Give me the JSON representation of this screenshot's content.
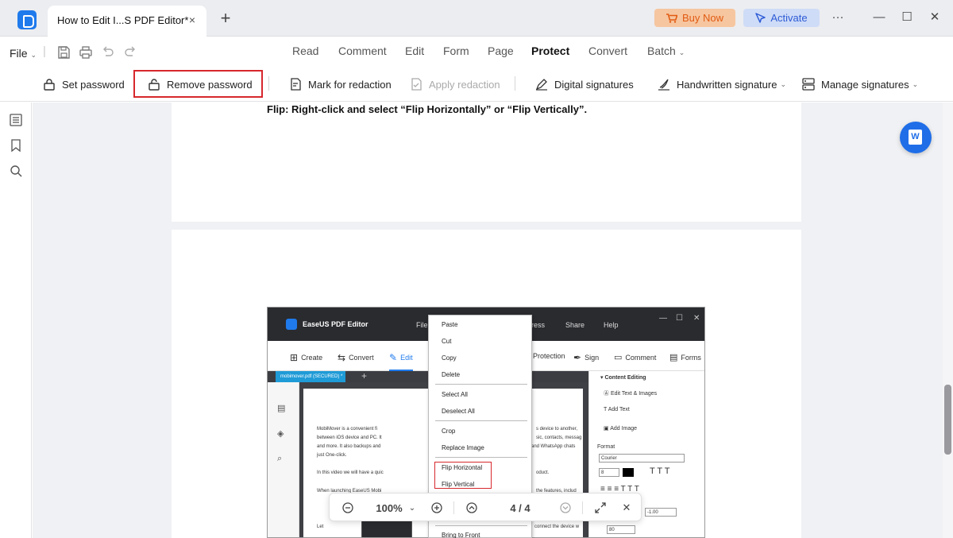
{
  "window": {
    "tab_title": "How to Edit I...S PDF Editor*",
    "tab_close": "×",
    "new_tab": "+",
    "buy_now": "Buy Now",
    "activate": "Activate",
    "more": "···",
    "minimize": "—",
    "maximize": "☐",
    "close": "✕"
  },
  "menu": {
    "file": "File",
    "tabs": [
      "Read",
      "Comment",
      "Edit",
      "Form",
      "Page",
      "Protect",
      "Convert",
      "Batch"
    ],
    "active_tab": "Protect"
  },
  "ribbon": {
    "set_password": "Set password",
    "remove_password": "Remove password",
    "mark_for_redaction": "Mark for redaction",
    "apply_redaction": "Apply redaction",
    "digital_signatures": "Digital signatures",
    "handwritten_signature": "Handwritten signature",
    "manage_signatures": "Manage signatures"
  },
  "document": {
    "flip_instruction": "Flip: Right-click and select “Flip Horizontally” or “Flip Vertically”."
  },
  "embedded": {
    "app_name": "EaseUS PDF Editor",
    "menus": [
      "File",
      "ress",
      "Share",
      "Help"
    ],
    "toolbar": [
      "Create",
      "Convert",
      "Edit",
      "Protection",
      "Sign",
      "Comment",
      "Forms"
    ],
    "file_tab": "mobimover.pdf (SECURED) *",
    "page_lines_left": [
      "MobiMover is a convenient fi",
      "between iOS device and PC. It",
      "and more. It also backups and",
      "just One-click.",
      "In this video we will have a quic",
      "When launching EaseUS Mobi",
      "Let"
    ],
    "page_lines_right": [
      "s device to another,",
      "sic, contacts, messag",
      "and WhatsApp chats",
      "oduct.",
      "the features, includ",
      "connect the device w"
    ],
    "right_panel": {
      "section": "Content Editing",
      "edit_text_images": "Edit Text & Images",
      "add_text": "Add Text",
      "add_image": "Add Image",
      "format": "Format",
      "font": "Courier",
      "size": "8",
      "spacing": "-1.00",
      "scale": "80"
    },
    "context_menu": [
      "Paste",
      "Cut",
      "Copy",
      "Delete",
      "Select All",
      "Deselect All",
      "Crop",
      "Replace Image",
      "Flip Horizontal",
      "Flip Vertical",
      "Bring to Front"
    ]
  },
  "zoom": {
    "level": "100%",
    "page_current": "4",
    "page_total": "4",
    "page_display": "4 / 4"
  }
}
